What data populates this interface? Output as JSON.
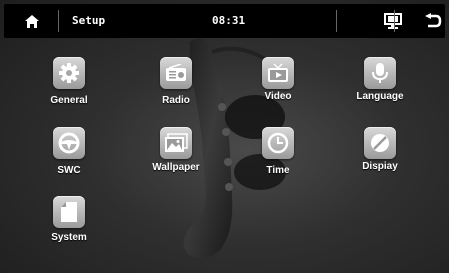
{
  "header": {
    "title": "Setup",
    "time": "08:31"
  },
  "icons": {
    "home": "home-icon",
    "screen": "screen-icon",
    "back": "back-icon"
  },
  "apps": [
    {
      "label": "General",
      "icon": "gear-icon"
    },
    {
      "label": "Radio",
      "icon": "radio-icon"
    },
    {
      "label": "Video",
      "icon": "tv-icon"
    },
    {
      "label": "Language",
      "icon": "microphone-icon"
    },
    {
      "label": "SWC",
      "icon": "steering-wheel-icon"
    },
    {
      "label": "Wallpaper",
      "icon": "picture-icon"
    },
    {
      "label": "Time",
      "icon": "clock-icon"
    },
    {
      "label": "Dispiay",
      "icon": "display-icon"
    },
    {
      "label": "System",
      "icon": "document-icon"
    }
  ]
}
